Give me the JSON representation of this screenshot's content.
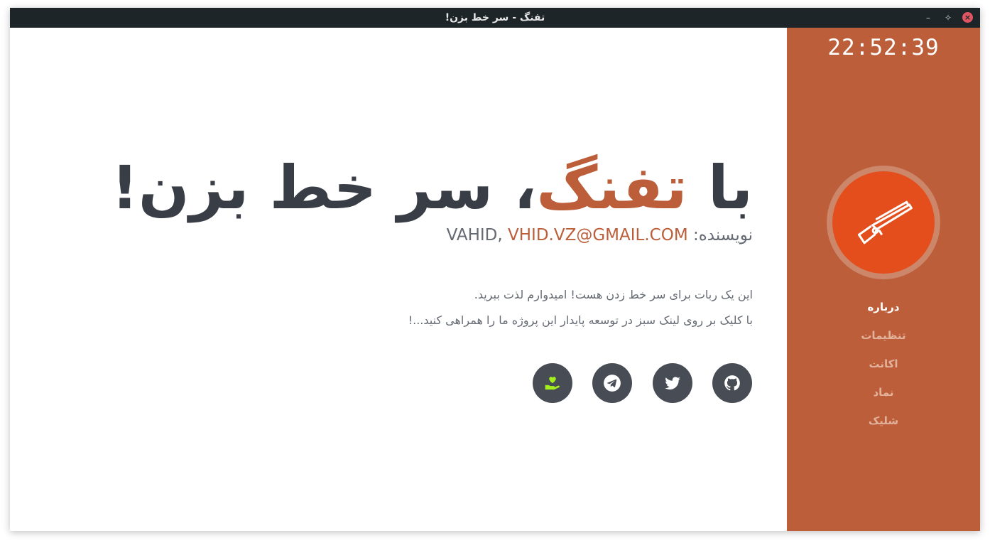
{
  "window": {
    "title": "تفنگ - سر خط بزن!",
    "controls": {
      "minimize": "–",
      "maximize": "✧",
      "close": "×"
    }
  },
  "main": {
    "headline_prefix": "با ",
    "headline_brand": "تفنگ",
    "headline_suffix": "، سر خط بزن!",
    "author_label": "نویسنده: ",
    "author_name": "VAHID",
    "author_sep": ", ",
    "author_email": "VHID.VZ@GMAIL.COM",
    "description": [
      "این یک ربات برای سر خط زدن هست! امیدوارم لذت ببرید.",
      "با کلیک بر روی لینک سبز در توسعه پایدار این پروژه ما را همراهی کنید...!"
    ],
    "social_links": [
      {
        "name": "github-icon"
      },
      {
        "name": "twitter-icon"
      },
      {
        "name": "telegram-icon"
      },
      {
        "name": "donate-icon",
        "color": "#a4ee1e"
      }
    ]
  },
  "sidebar": {
    "clock": "22:52:39",
    "accent_color": "#bb5e39",
    "logo_color": "#e34e1c",
    "logo_icon": "rifle-icon",
    "nav": [
      {
        "label": "درباره",
        "active": true
      },
      {
        "label": "تنظیمات",
        "active": false
      },
      {
        "label": "اکانت",
        "active": false
      },
      {
        "label": "نماد",
        "active": false
      },
      {
        "label": "شلیک",
        "active": false
      }
    ]
  }
}
